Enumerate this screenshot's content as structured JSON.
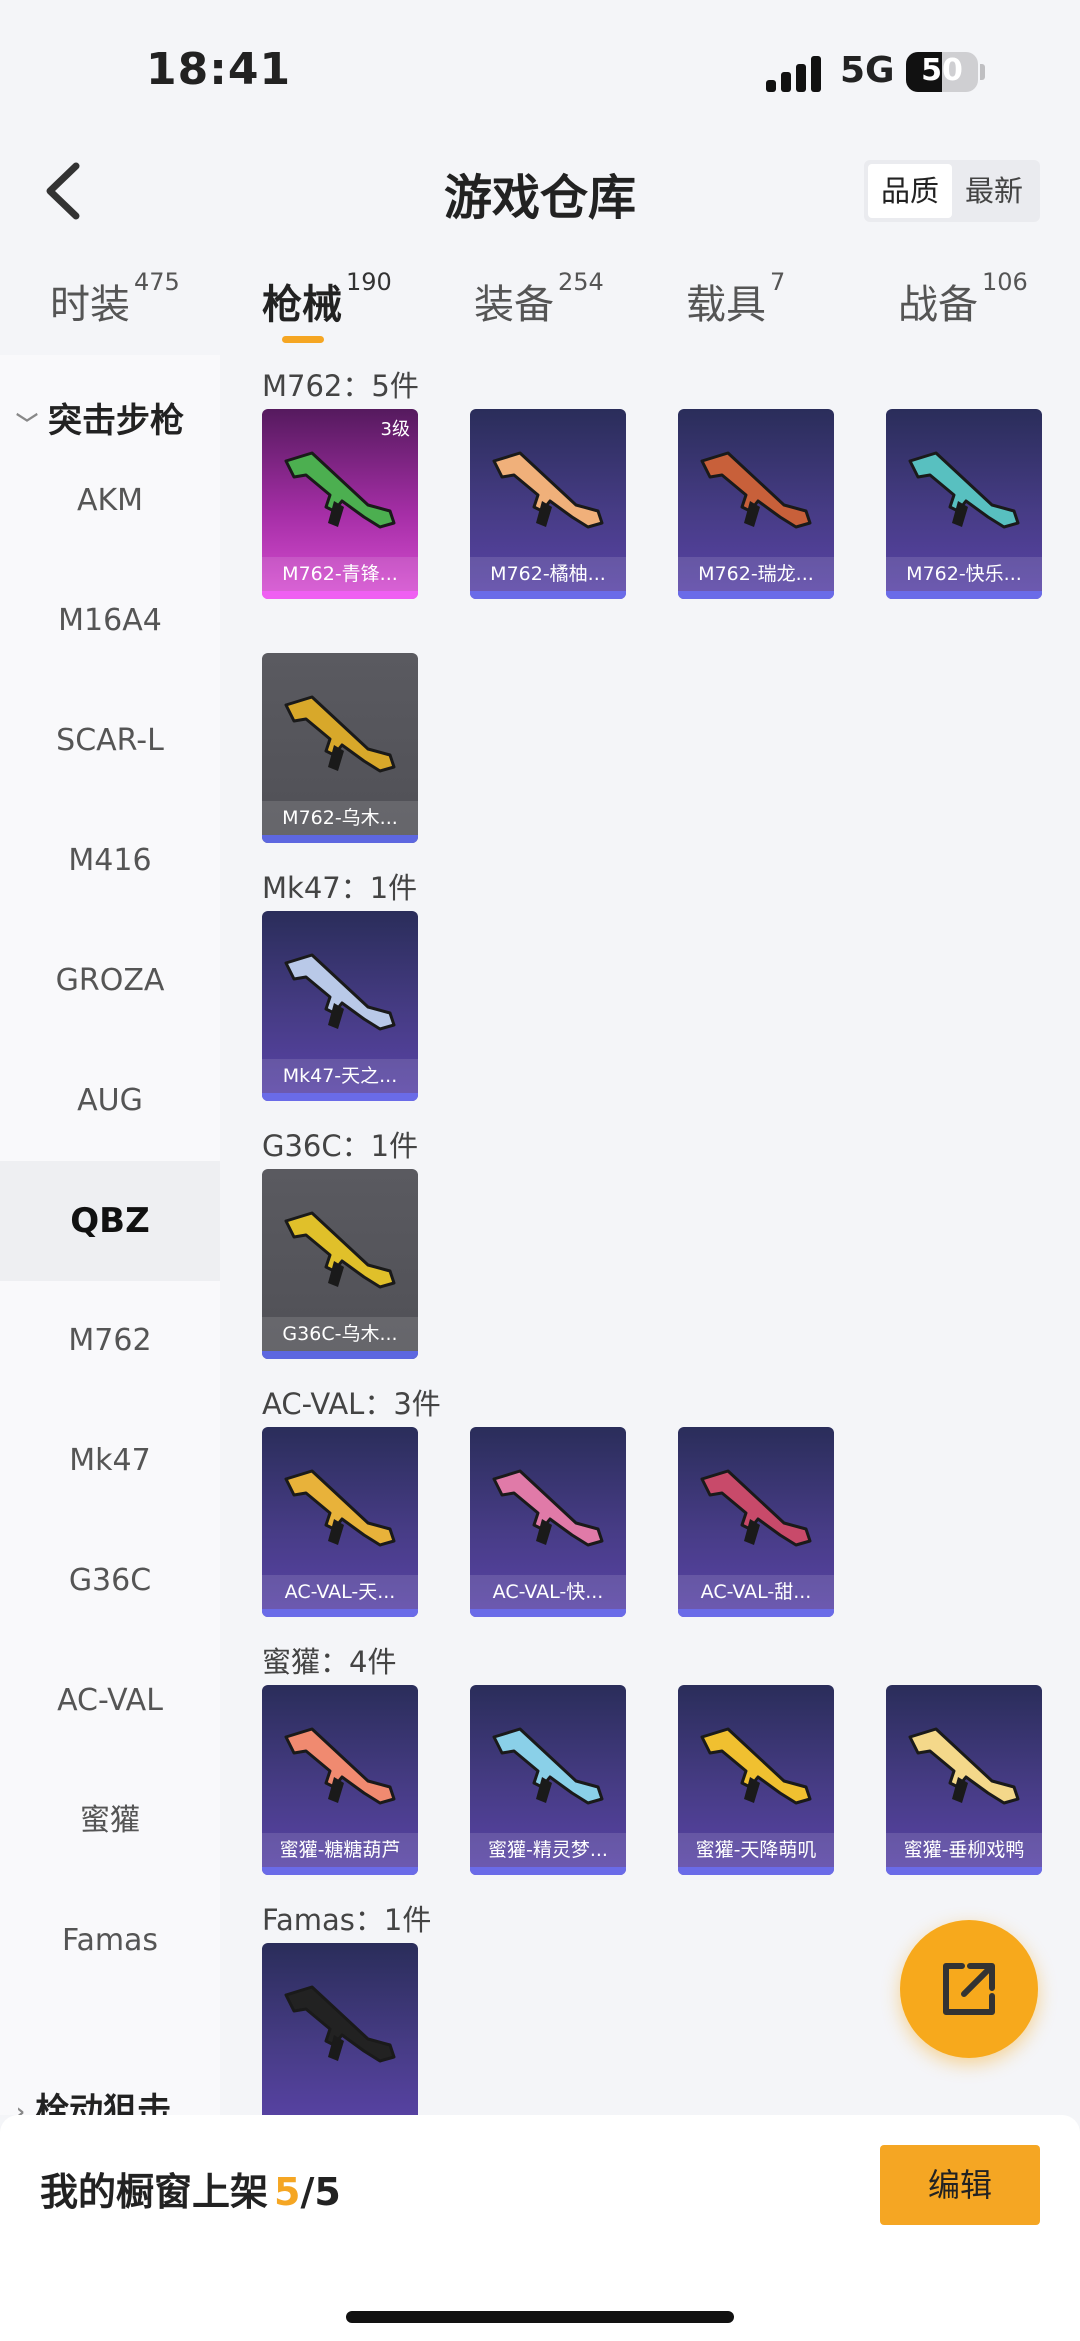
{
  "status_bar": {
    "time": "18:41",
    "network": "5G",
    "battery": "50",
    "battery_level": 0.5
  },
  "header": {
    "title": "游戏仓库",
    "sort_options": [
      "品质",
      "最新"
    ]
  },
  "tabs": [
    {
      "label": "时装",
      "count": "475"
    },
    {
      "label": "枪械",
      "count": "190"
    },
    {
      "label": "装备",
      "count": "254"
    },
    {
      "label": "载具",
      "count": "7"
    },
    {
      "label": "战备",
      "count": "106"
    }
  ],
  "sidebar": {
    "group_open": "突击步枪",
    "items": [
      "AKM",
      "M16A4",
      "SCAR-L",
      "M416",
      "GROZA",
      "AUG",
      "QBZ",
      "M762",
      "Mk47",
      "G36C",
      "AC-VAL",
      "蜜獾",
      "Famas"
    ],
    "group_closed": "栓动狙击"
  },
  "sections": [
    {
      "title": "M762：5件",
      "items": [
        {
          "name": "M762-青锋...",
          "level": "3级",
          "style": "pink"
        },
        {
          "name": "M762-橘柚...",
          "style": "purple"
        },
        {
          "name": "M762-瑞龙...",
          "style": "purple"
        },
        {
          "name": "M762-快乐...",
          "style": "purple"
        },
        {
          "name": "M762-乌木...",
          "style": "gray"
        }
      ]
    },
    {
      "title": "Mk47：1件",
      "items": [
        {
          "name": "Mk47-天之...",
          "style": "purple"
        }
      ]
    },
    {
      "title": "G36C：1件",
      "items": [
        {
          "name": "G36C-乌木...",
          "style": "gray"
        }
      ]
    },
    {
      "title": "AC-VAL：3件",
      "items": [
        {
          "name": "AC-VAL-天...",
          "style": "purple"
        },
        {
          "name": "AC-VAL-快...",
          "style": "purple"
        },
        {
          "name": "AC-VAL-甜...",
          "style": "purple"
        }
      ]
    },
    {
      "title": "蜜獾：4件",
      "items": [
        {
          "name": "蜜獾-糖糖葫芦",
          "style": "purple"
        },
        {
          "name": "蜜獾-精灵梦...",
          "style": "purple"
        },
        {
          "name": "蜜獾-天降萌叽",
          "style": "purple"
        },
        {
          "name": "蜜獾-垂柳戏鸭",
          "style": "purple"
        }
      ]
    },
    {
      "title": "Famas：1件",
      "items": [
        {
          "name": "",
          "style": "purple"
        }
      ]
    }
  ],
  "bottom_bar": {
    "label": "我的橱窗上架",
    "current": "5",
    "total": "/5",
    "edit_label": "编辑"
  },
  "colors": {
    "accent": "#f5a623",
    "background": "#f4f5f8"
  }
}
